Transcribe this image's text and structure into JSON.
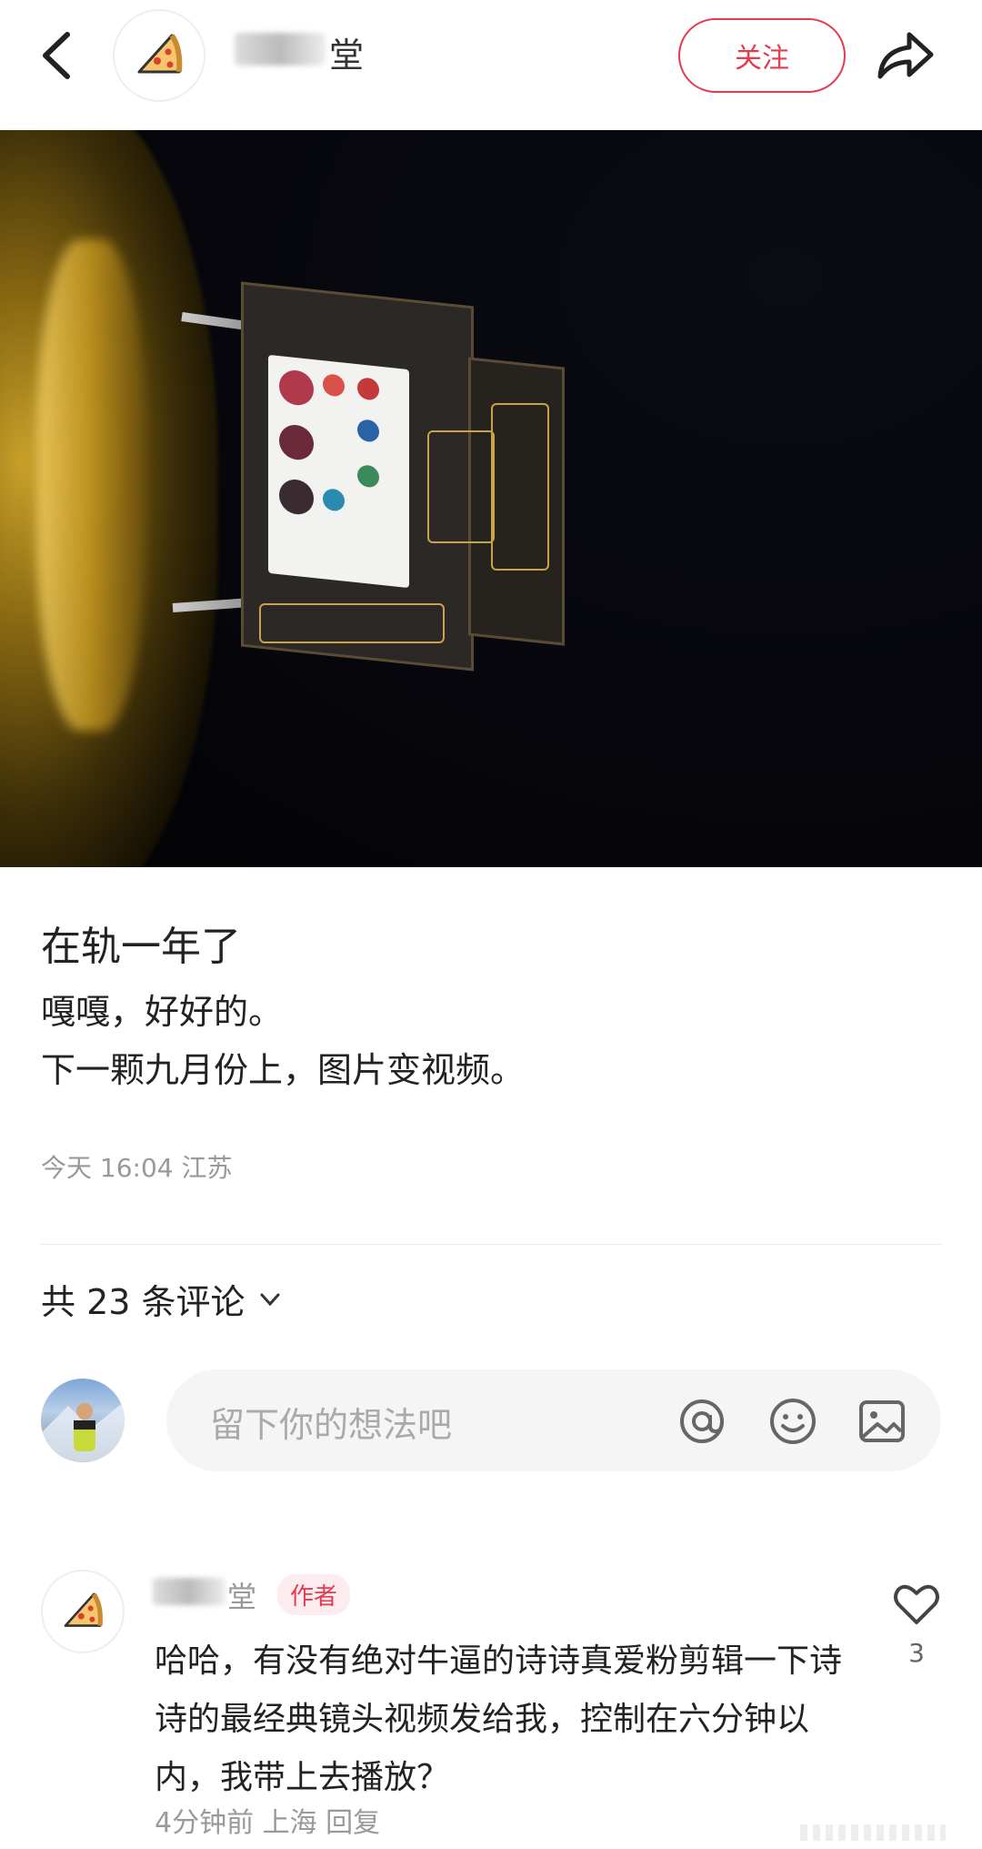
{
  "header": {
    "username_visible": "堂",
    "follow_label": "关注"
  },
  "post": {
    "title": "在轨一年了",
    "body_lines": [
      "嘎嘎，好好的。",
      "下一颗九月份上，图片变视频。"
    ],
    "meta": "今天 16:04 江苏"
  },
  "comments": {
    "count_label": "共 23 条评论",
    "input_placeholder": "留下你的想法吧",
    "items": [
      {
        "name_visible": "堂",
        "badge": "作者",
        "text": "哈哈，有没有绝对牛逼的诗诗真爱粉剪辑一下诗诗的最经典镜头视频发给我，控制在六分钟以内，我带上去播放？",
        "meta": "4分钟前 上海 回复",
        "likes": "3"
      }
    ]
  },
  "icons": {
    "back": "back-arrow-icon",
    "share": "share-icon",
    "at": "at-icon",
    "emoji": "emoji-icon",
    "image": "image-icon",
    "like": "heart-icon",
    "chevron": "chevron-down-icon",
    "avatar": "pizza-icon"
  },
  "colors": {
    "accent": "#e33b4f",
    "badge_bg": "#fdecef"
  }
}
